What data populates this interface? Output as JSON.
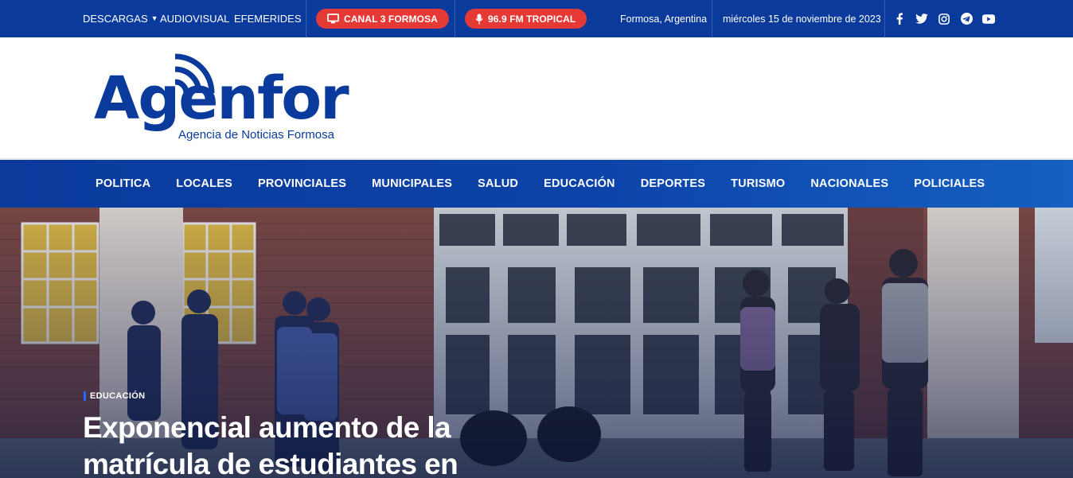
{
  "topbar": {
    "links": [
      "DESCARGAS",
      "AUDIOVISUAL",
      "EFEMERIDES"
    ],
    "tv_label": "CANAL 3 FORMOSA",
    "radio_label": "96.9 FM TROPICAL",
    "location": "Formosa, Argentina",
    "date": "miércoles 15 de noviembre de 2023",
    "social_icons": [
      "facebook-icon",
      "twitter-icon",
      "instagram-icon",
      "telegram-icon",
      "youtube-icon"
    ]
  },
  "brand": {
    "name": "Agenfor",
    "tagline": "Agencia de Noticias Formosa",
    "color": "#0a3a9c",
    "accent": "#e53935"
  },
  "nav": {
    "items": [
      "POLITICA",
      "LOCALES",
      "PROVINCIALES",
      "MUNICIPALES",
      "SALUD",
      "EDUCACIÓN",
      "DEPORTES",
      "TURISMO",
      "NACIONALES",
      "POLICIALES"
    ]
  },
  "hero": {
    "category": "EDUCACIÓN",
    "headline": "Exponencial aumento de la matrícula de estudiantes en"
  }
}
